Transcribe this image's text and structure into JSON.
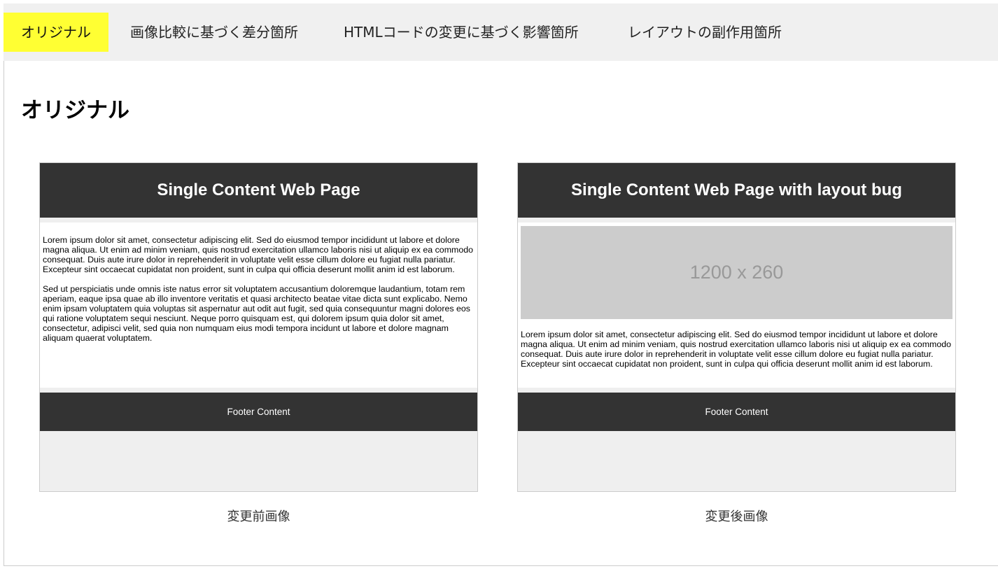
{
  "tabs": [
    {
      "label": "オリジナル",
      "active": true
    },
    {
      "label": "画像比較に基づく差分箇所",
      "active": false
    },
    {
      "label": "HTMLコードの変更に基づく影響箇所",
      "active": false
    },
    {
      "label": "レイアウトの副作用箇所",
      "active": false
    }
  ],
  "section_title": "オリジナル",
  "before": {
    "header": "Single Content Web Page",
    "paragraphs": [
      "Lorem ipsum dolor sit amet, consectetur adipiscing elit. Sed do eiusmod tempor incididunt ut labore et dolore magna aliqua. Ut enim ad minim veniam, quis nostrud exercitation ullamco laboris nisi ut aliquip ex ea commodo consequat. Duis aute irure dolor in reprehenderit in voluptate velit esse cillum dolore eu fugiat nulla pariatur. Excepteur sint occaecat cupidatat non proident, sunt in culpa qui officia deserunt mollit anim id est laborum.",
      "Sed ut perspiciatis unde omnis iste natus error sit voluptatem accusantium doloremque laudantium, totam rem aperiam, eaque ipsa quae ab illo inventore veritatis et quasi architecto beatae vitae dicta sunt explicabo. Nemo enim ipsam voluptatem quia voluptas sit aspernatur aut odit aut fugit, sed quia consequuntur magni dolores eos qui ratione voluptatem sequi nesciunt. Neque porro quisquam est, qui dolorem ipsum quia dolor sit amet, consectetur, adipisci velit, sed quia non numquam eius modi tempora incidunt ut labore et dolore magnam aliquam quaerat voluptatem."
    ],
    "footer": "Footer Content",
    "caption": "変更前画像"
  },
  "after": {
    "header": "Single Content Web Page with layout bug",
    "image_placeholder": "1200 x 260",
    "paragraphs": [
      "Lorem ipsum dolor sit amet, consectetur adipiscing elit. Sed do eiusmod tempor incididunt ut labore et dolore magna aliqua. Ut enim ad minim veniam, quis nostrud exercitation ullamco laboris nisi ut aliquip ex ea commodo consequat. Duis aute irure dolor in reprehenderit in voluptate velit esse cillum dolore eu fugiat nulla pariatur. Excepteur sint occaecat cupidatat non proident, sunt in culpa qui officia deserunt mollit anim id est laborum."
    ],
    "footer": "Footer Content",
    "caption": "変更後画像"
  },
  "colors": {
    "active_tab": "#ffff33",
    "tabbar_bg": "#f0f0f0",
    "panel_dark": "#333333",
    "placeholder_bg": "#cccccc"
  }
}
